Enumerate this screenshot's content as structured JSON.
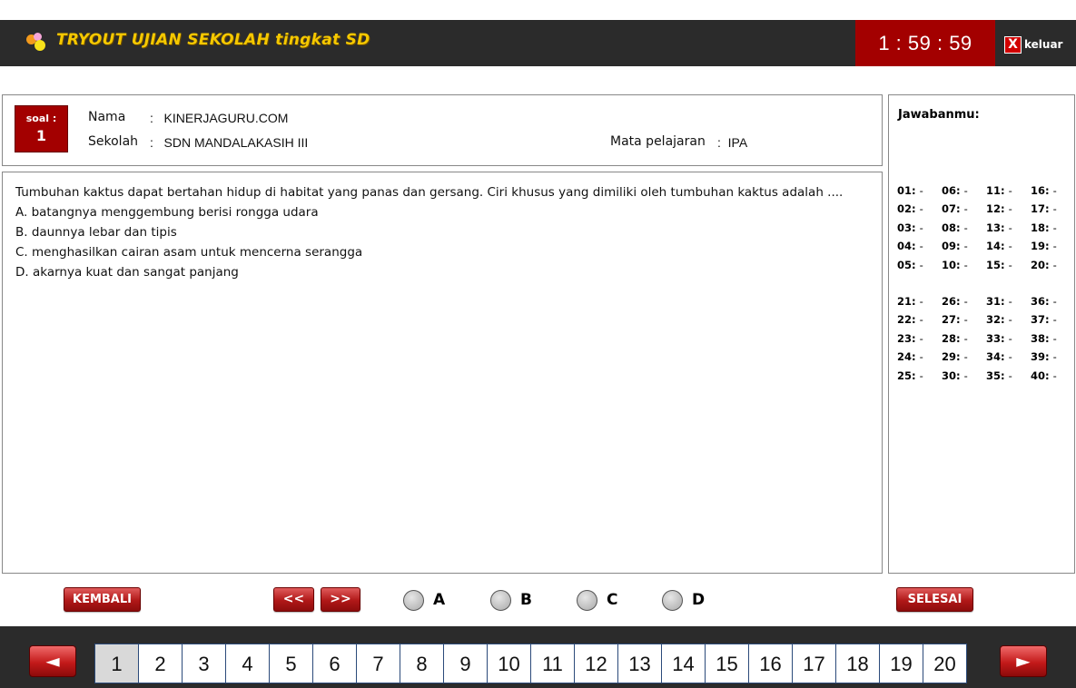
{
  "header": {
    "title": "TRYOUT UJIAN SEKOLAH tingkat SD",
    "timer": "1 : 59 : 59",
    "exit_icon": "X",
    "exit_label": "keluar"
  },
  "info": {
    "soal_label": "soal :",
    "soal_number": "1",
    "nama_label": "Nama",
    "nama_value": ":   KINERJAGURU.COM",
    "sekolah_label": "Sekolah",
    "sekolah_value": ":   SDN MANDALAKASIH III",
    "mapel_label": "Mata pelajaran",
    "mapel_value": ":  IPA"
  },
  "question": {
    "text": "Tumbuhan kaktus dapat bertahan hidup di habitat yang panas dan gersang. Ciri khusus yang dimiliki oleh tumbuhan kaktus adalah ....",
    "options": [
      "A.  batangnya menggembung berisi rongga udara",
      "B.  daunnya lebar dan tipis",
      "C.  menghasilkan cairan asam untuk mencerna serangga",
      "D.  akarnya kuat dan sangat panjang"
    ]
  },
  "answers": {
    "title": "Jawabanmu:",
    "block1": [
      "01:",
      "06:",
      "11:",
      "16:",
      "02:",
      "07:",
      "12:",
      "17:",
      "03:",
      "08:",
      "13:",
      "18:",
      "04:",
      "09:",
      "14:",
      "19:",
      "05:",
      "10:",
      "15:",
      "20:"
    ],
    "block2": [
      "21:",
      "26:",
      "31:",
      "36:",
      "22:",
      "27:",
      "32:",
      "37:",
      "23:",
      "28:",
      "33:",
      "38:",
      "24:",
      "29:",
      "34:",
      "39:",
      "25:",
      "30:",
      "35:",
      "40:"
    ],
    "empty_value": "-"
  },
  "controls": {
    "back_label": "KEMBALI",
    "prev_label": "<<",
    "next_label": ">>",
    "finish_label": "SELESAI",
    "choices": [
      "A",
      "B",
      "C",
      "D"
    ]
  },
  "pagination": {
    "prev_icon": "◄",
    "next_icon": "►",
    "pages": [
      "1",
      "2",
      "3",
      "4",
      "5",
      "6",
      "7",
      "8",
      "9",
      "10",
      "11",
      "12",
      "13",
      "14",
      "15",
      "16",
      "17",
      "18",
      "19",
      "20"
    ],
    "active_page": "1"
  },
  "colors": {
    "bar": "#2b2b2b",
    "accent_red": "#a30000",
    "title_yellow": "#f5c800"
  }
}
